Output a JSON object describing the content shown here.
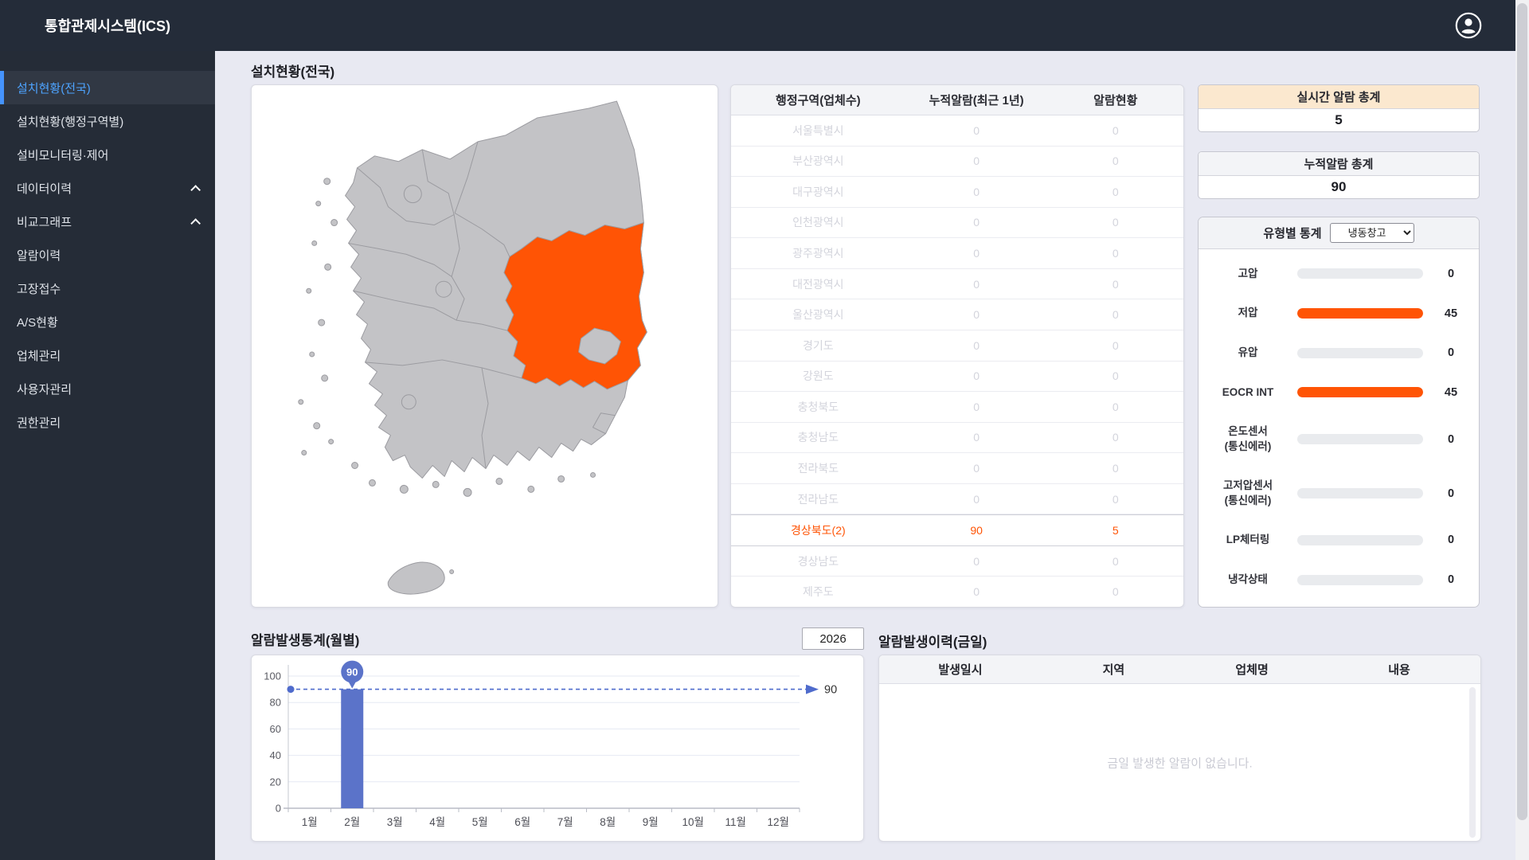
{
  "header": {
    "title": "통합관제시스템(ICS)"
  },
  "sidebar": {
    "items": [
      {
        "label": "설치현황(전국)",
        "active": true,
        "chevron": false
      },
      {
        "label": "설치현황(행정구역별)",
        "active": false,
        "chevron": false
      },
      {
        "label": "설비모니터링·제어",
        "active": false,
        "chevron": false
      },
      {
        "label": "데이터이력",
        "active": false,
        "chevron": true
      },
      {
        "label": "비교그래프",
        "active": false,
        "chevron": true
      },
      {
        "label": "알람이력",
        "active": false,
        "chevron": false
      },
      {
        "label": "고장접수",
        "active": false,
        "chevron": false
      },
      {
        "label": "A/S현황",
        "active": false,
        "chevron": false
      },
      {
        "label": "업체관리",
        "active": false,
        "chevron": false
      },
      {
        "label": "사용자관리",
        "active": false,
        "chevron": false
      },
      {
        "label": "권한관리",
        "active": false,
        "chevron": false
      }
    ]
  },
  "main": {
    "install_title": "설치현황(전국)",
    "region_table": {
      "headers": [
        "행정구역(업체수)",
        "누적알람(최근 1년)",
        "알람현황"
      ],
      "rows": [
        {
          "region": "서울특별시",
          "cumulative": "0",
          "current": "0",
          "highlight": false
        },
        {
          "region": "부산광역시",
          "cumulative": "0",
          "current": "0",
          "highlight": false
        },
        {
          "region": "대구광역시",
          "cumulative": "0",
          "current": "0",
          "highlight": false
        },
        {
          "region": "인천광역시",
          "cumulative": "0",
          "current": "0",
          "highlight": false
        },
        {
          "region": "광주광역시",
          "cumulative": "0",
          "current": "0",
          "highlight": false
        },
        {
          "region": "대전광역시",
          "cumulative": "0",
          "current": "0",
          "highlight": false
        },
        {
          "region": "울산광역시",
          "cumulative": "0",
          "current": "0",
          "highlight": false
        },
        {
          "region": "경기도",
          "cumulative": "0",
          "current": "0",
          "highlight": false
        },
        {
          "region": "강원도",
          "cumulative": "0",
          "current": "0",
          "highlight": false
        },
        {
          "region": "충청북도",
          "cumulative": "0",
          "current": "0",
          "highlight": false
        },
        {
          "region": "충청남도",
          "cumulative": "0",
          "current": "0",
          "highlight": false
        },
        {
          "region": "전라북도",
          "cumulative": "0",
          "current": "0",
          "highlight": false
        },
        {
          "region": "전라남도",
          "cumulative": "0",
          "current": "0",
          "highlight": false
        },
        {
          "region": "경상북도(2)",
          "cumulative": "90",
          "current": "5",
          "highlight": true
        },
        {
          "region": "경상남도",
          "cumulative": "0",
          "current": "0",
          "highlight": false
        },
        {
          "region": "제주도",
          "cumulative": "0",
          "current": "0",
          "highlight": false
        }
      ]
    },
    "realtime": {
      "title": "실시간 알람 총계",
      "value": "5"
    },
    "cumulative": {
      "title": "누적알람 총계",
      "value": "90"
    },
    "type_stats": {
      "title": "유형별 통계",
      "selected_option": "냉동창고",
      "max": 45,
      "rows": [
        {
          "label": "고압",
          "value": 0
        },
        {
          "label": "저압",
          "value": 45
        },
        {
          "label": "유압",
          "value": 0
        },
        {
          "label": "EOCR INT",
          "value": 45
        },
        {
          "label": "온도센서\n(통신에러)",
          "value": 0
        },
        {
          "label": "고저압센서\n(통신에러)",
          "value": 0
        },
        {
          "label": "LP체터링",
          "value": 0
        },
        {
          "label": "냉각상태",
          "value": 0
        }
      ]
    },
    "monthly_chart": {
      "title": "알람발생통계(월별)",
      "year": "2026"
    },
    "today_history": {
      "title": "알람발생이력(금일)",
      "headers": [
        "발생일시",
        "지역",
        "업체명",
        "내용"
      ],
      "empty_message": "금일 발생한 알람이 없습니다."
    }
  },
  "chart_data": {
    "type": "bar",
    "title": "알람발생통계(월별)",
    "categories": [
      "1월",
      "2월",
      "3월",
      "4월",
      "5월",
      "6월",
      "7월",
      "8월",
      "9월",
      "10월",
      "11월",
      "12월"
    ],
    "values": [
      0,
      90,
      0,
      0,
      0,
      0,
      0,
      0,
      0,
      0,
      0,
      0
    ],
    "xlabel": "",
    "ylabel": "",
    "ylim": [
      0,
      100
    ],
    "yticks": [
      0,
      20,
      40,
      60,
      80,
      100
    ],
    "grid": true,
    "max_line": {
      "value": 90,
      "label": "90"
    },
    "point_label": {
      "category": "2월",
      "value": 90
    }
  },
  "colors": {
    "highlight_orange": "#ff5405",
    "bar_blue": "#5b73c9",
    "dashed_line_blue": "#4f6bcc",
    "active_menu_blue": "#4da3ff",
    "realtime_header_peach": "#fbe8cf",
    "map_region_gray": "#c3c3c6",
    "map_border_gray": "#9b9ba0"
  }
}
